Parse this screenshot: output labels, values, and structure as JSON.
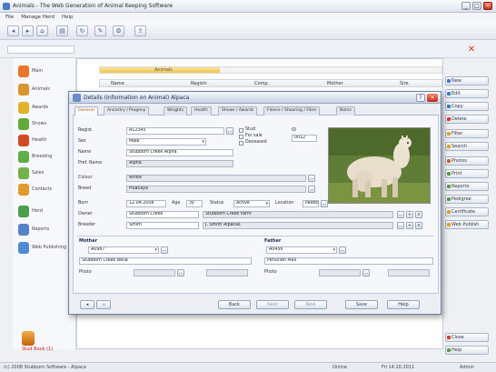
{
  "window": {
    "title": "Animals - The Web Generation of Animal Keeping Software",
    "minimize": "_",
    "maximize": "□",
    "close": "×"
  },
  "menu": [
    "File",
    "Manage Herd",
    "Help"
  ],
  "toolbar": {
    "buttons": [
      {
        "icon": "back-arrow-icon",
        "glyph": "◂"
      },
      {
        "icon": "forward-arrow-icon",
        "glyph": "▸"
      },
      {
        "icon": "home-icon",
        "glyph": "⌂"
      },
      {
        "icon": "print-icon",
        "glyph": "▤"
      },
      {
        "icon": "refresh-icon",
        "glyph": "↻"
      },
      {
        "icon": "tools-icon",
        "glyph": "✎"
      },
      {
        "icon": "settings-icon",
        "glyph": "⚙"
      },
      {
        "icon": "upload-icon",
        "glyph": "⇪"
      }
    ]
  },
  "search": {
    "placeholder": ""
  },
  "sidebar": {
    "items": [
      {
        "label": "Main",
        "color": "#e8742a"
      },
      {
        "label": "Animals",
        "color": "#d9962e"
      },
      {
        "label": "Awards",
        "color": "#e3b12a"
      },
      {
        "label": "Shows",
        "color": "#63a83a"
      },
      {
        "label": "Health",
        "color": "#d04a22"
      },
      {
        "label": "Breeding",
        "color": "#5fae45"
      },
      {
        "label": "Sales",
        "color": "#6fb34a"
      },
      {
        "label": "Contacts",
        "color": "#e19a2e"
      },
      {
        "label": "Herd",
        "color": "#4aa04a"
      },
      {
        "label": "Reports",
        "color": "#5582c8"
      },
      {
        "label": "Web Publishing",
        "color": "#4d8bd4"
      }
    ],
    "bottom_label": "Stud Book (1)"
  },
  "mainpane": {
    "progress_label": "Animals",
    "progress": 0.35,
    "columns": [
      "Name",
      "Registr.",
      "Comp.",
      "Mother",
      "Sire"
    ]
  },
  "rightcol": {
    "buttons": [
      {
        "label": "New",
        "color": "#3e7cc8"
      },
      {
        "label": "Edit",
        "color": "#3e7cc8"
      },
      {
        "label": "Copy",
        "color": "#3e7cc8"
      },
      {
        "label": "Delete",
        "color": "#d0402a"
      },
      {
        "label": "Filter",
        "color": "#e1a22a"
      },
      {
        "label": "Search",
        "color": "#e1a22a"
      },
      {
        "label": "Photos",
        "color": "#d0602a"
      },
      {
        "label": "Print",
        "color": "#5aa040"
      },
      {
        "label": "Reports",
        "color": "#5aa040"
      },
      {
        "label": "Pedigree",
        "color": "#5aa040"
      },
      {
        "label": "Certificate",
        "color": "#e1a22a"
      },
      {
        "label": "Web Publish",
        "color": "#e1a22a"
      }
    ],
    "bottom_buttons": [
      {
        "label": "Close",
        "color": "#d0402a"
      },
      {
        "label": "Help",
        "color": "#5aa040"
      }
    ]
  },
  "dialog": {
    "title": "Details (Information on Animal) Alpaca",
    "help": "?",
    "close": "×",
    "tabs": [
      "General",
      "Ancestry / Progeny",
      "Weights",
      "Health",
      "Shows / Awards",
      "Fleece / Shearing / Fibre",
      "Notes"
    ],
    "fields": {
      "registration_label": "Regist.",
      "registration_value": "A12345",
      "sex_label": "Sex",
      "sex_value": "Male",
      "name_label": "Name",
      "name_value": "Stubborn Creek Alpha",
      "prefix_label": "Pref. Name",
      "prefix_value": "Alpha",
      "colour_label": "Colour",
      "colour_value": "White",
      "breed_label": "Breed",
      "breed_value": "Huacaya",
      "born_label": "Born",
      "born_value": "12.04.2008",
      "age_label": "Age",
      "age_value": "3y",
      "status_label": "Status",
      "status_value": "Active",
      "location_label": "Location",
      "location_value": "Paddock 2",
      "owner_label": "Owner",
      "owner_value": "Stubborn Creek",
      "owner_detail": "Stubborn Creek Farm",
      "breeder_label": "Breeder",
      "breeder_value": "Smith",
      "breeder_detail": "J. Smith Alpacas",
      "check1": "Stud",
      "check2": "For sale",
      "check3": "Deceased",
      "id_label": "ID",
      "id_value": "0012"
    },
    "sections": {
      "mother_title": "Mother",
      "mother_reg": "A0987",
      "mother_name": "Stubborn Creek Bella",
      "mother_photo_label": "Photo",
      "father_title": "Father",
      "father_reg": "A0456",
      "father_name": "Peruvian Max",
      "father_photo_label": "Photo"
    },
    "footer": {
      "back": "Back",
      "next": "Next",
      "new": "New",
      "save": "Save",
      "help": "Help"
    }
  },
  "statusbar": {
    "left": "(c) 2008 Stubborn Software - Alpaca",
    "mid": "Online",
    "date": "Fri 14.10.2011",
    "user": "Admin"
  }
}
